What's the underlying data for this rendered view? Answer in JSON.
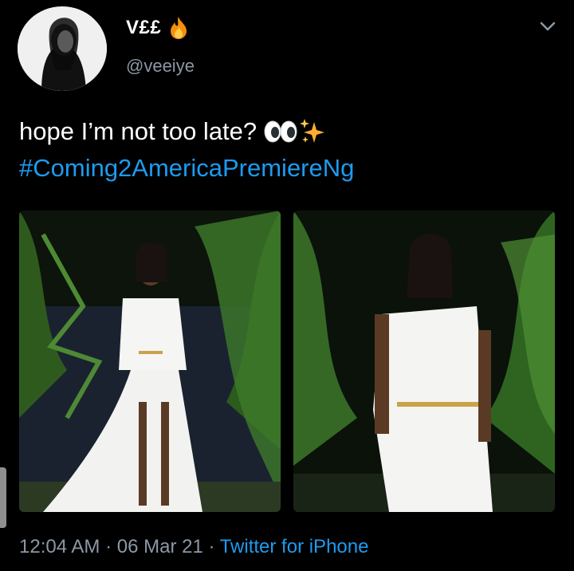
{
  "author": {
    "display_name": "V££",
    "handle": "@veeiye",
    "avatar_icon": "profile-photo",
    "badge_icon": "fire-icon"
  },
  "tweet": {
    "text": "hope I’m not too late?",
    "emojis": [
      "eyes-emoji",
      "sparkles-emoji"
    ],
    "hashtag": "#Coming2AmericaPremiereNg"
  },
  "media": {
    "count": 2,
    "photos": [
      {
        "description_icon": "photo-woman-white-dress-full"
      },
      {
        "description_icon": "photo-woman-white-dress-closeup"
      }
    ]
  },
  "meta": {
    "time": "12:04 AM",
    "separator1": " · ",
    "date": "06 Mar 21",
    "separator2": " · ",
    "source": "Twitter for iPhone"
  },
  "colors": {
    "background": "#000000",
    "link": "#1d9bf0",
    "muted": "#8b98a5"
  }
}
